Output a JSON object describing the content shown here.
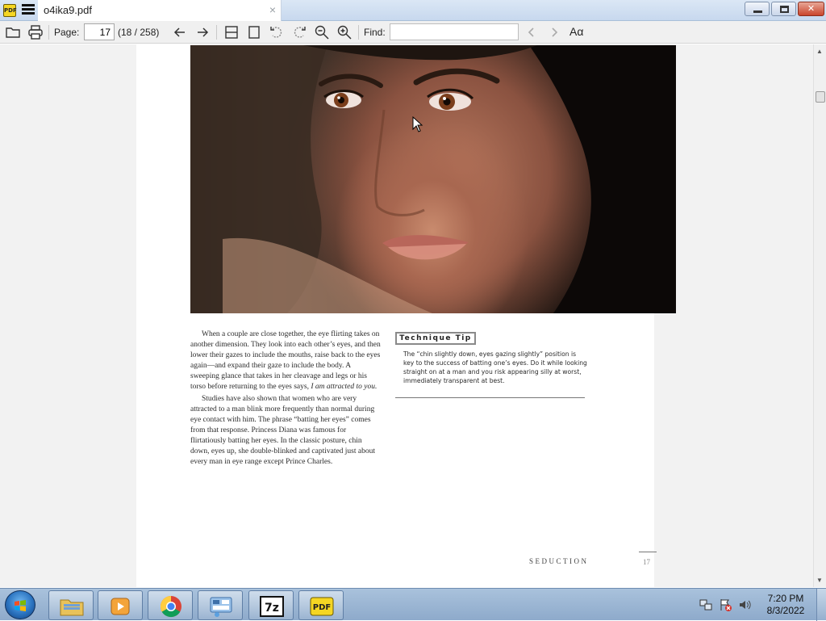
{
  "window": {
    "tab_title": "o4ika9.pdf",
    "tab_close": "×",
    "app_icon_text": "PDF",
    "controls": {
      "minimize": "",
      "maximize": "",
      "close": "✕"
    }
  },
  "toolbar": {
    "page_label": "Page:",
    "page_value": "17",
    "page_count": "(18 / 258)",
    "find_label": "Find:",
    "find_value": "",
    "font_button": "Aα"
  },
  "document": {
    "body_paragraphs": [
      "When a couple are close together, the eye flirting takes on another dimension. They look into each other’s eyes, and then lower their gazes to include the mouths, raise back to the eyes again—and expand their gaze to include the body. A sweeping glance that takes in her cleavage and legs or his torso before returning to the eyes says,",
      "I am attracted to you.",
      "Studies have also shown that women who are very attracted to a man blink more frequently than normal during eye contact with him. The phrase “batting her eyes” comes from that response. Princess Diana was famous for flirtatiously batting her eyes. In the classic posture, chin down, eyes up, she double-blinked and captivated just about every man in eye range except Prince Charles."
    ],
    "tip_heading": "Technique Tip",
    "tip_text": "The “chin slightly down, eyes gazing slightly” position is key to the success of batting one’s eyes. Do it while looking straight on at a man and you risk appearing silly at worst, immediately transparent at best.",
    "footer_label": "SEDUCTION",
    "page_number": "17"
  },
  "taskbar": {
    "apps": [
      "file-explorer",
      "media-player",
      "chrome",
      "control-panel",
      "7-zip",
      "pdf-reader"
    ],
    "sevenzip_label": "7z",
    "pdf_label": "PDF",
    "time": "7:20 PM",
    "date": "8/3/2022"
  }
}
